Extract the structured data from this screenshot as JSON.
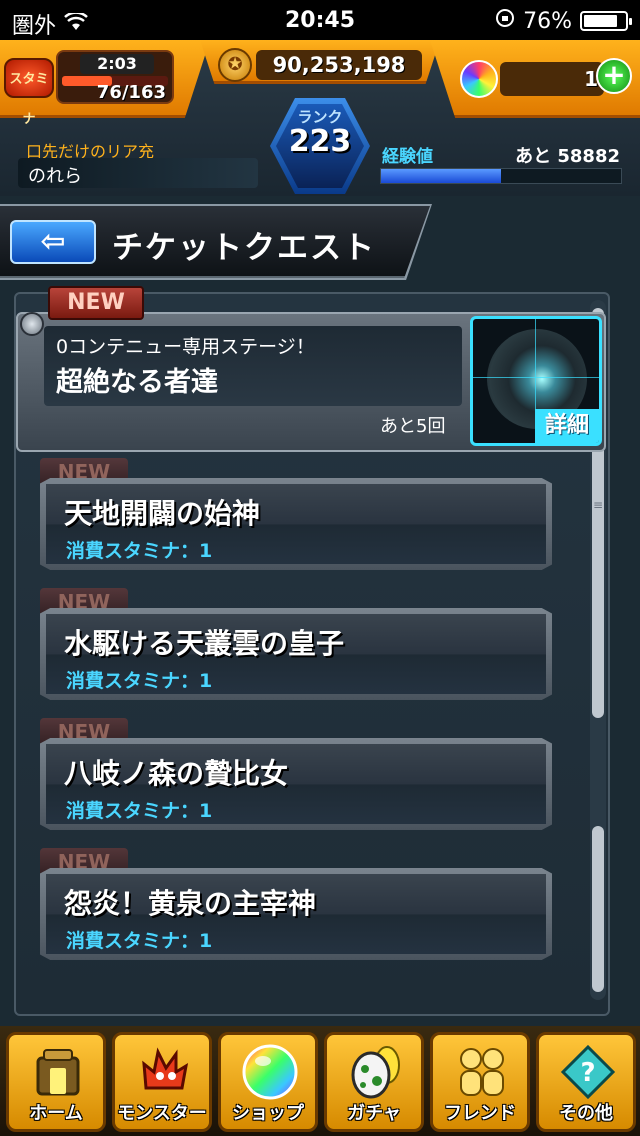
{
  "status_bar": {
    "carrier": "圏外",
    "time": "20:45",
    "battery_percent": "76%",
    "battery_level": 0.76
  },
  "header": {
    "stamina_label": "スタミナ",
    "stamina_timer": "2:03",
    "stamina_count": "76/163",
    "stamina_fill": 0.47,
    "gold": "90,253,198",
    "orbs": "1",
    "user_title": "口先だけのリア充",
    "user_name": "のれら",
    "rank_label": "ランク",
    "rank_value": "223",
    "exp_label": "経験値",
    "exp_remaining": "あと 58882",
    "exp_fill": 0.5
  },
  "page": {
    "title": "チケットクエスト"
  },
  "featured": {
    "new_badge": "NEW",
    "subtitle": "0コンテニュー専用ステージ！",
    "title": "超絶なる者達",
    "remaining": "あと5回",
    "detail_label": "詳細"
  },
  "quests": [
    {
      "new_badge": "NEW",
      "title": "天地開闢の始神",
      "cost": "消費スタミナ：1"
    },
    {
      "new_badge": "NEW",
      "title": "水駆ける天叢雲の皇子",
      "cost": "消費スタミナ：1"
    },
    {
      "new_badge": "NEW",
      "title": "八岐ノ森の贄比女",
      "cost": "消費スタミナ：1"
    },
    {
      "new_badge": "NEW",
      "title": "怨炎！黄泉の主宰神",
      "cost": "消費スタミナ：1"
    }
  ],
  "nav": [
    {
      "label": "ホーム",
      "icon": "home-icon"
    },
    {
      "label": "モンスター",
      "icon": "monster-icon"
    },
    {
      "label": "ショップ",
      "icon": "shop-orb-icon"
    },
    {
      "label": "ガチャ",
      "icon": "gacha-egg-icon"
    },
    {
      "label": "フレンド",
      "icon": "friends-icon"
    },
    {
      "label": "その他",
      "icon": "other-icon"
    }
  ]
}
